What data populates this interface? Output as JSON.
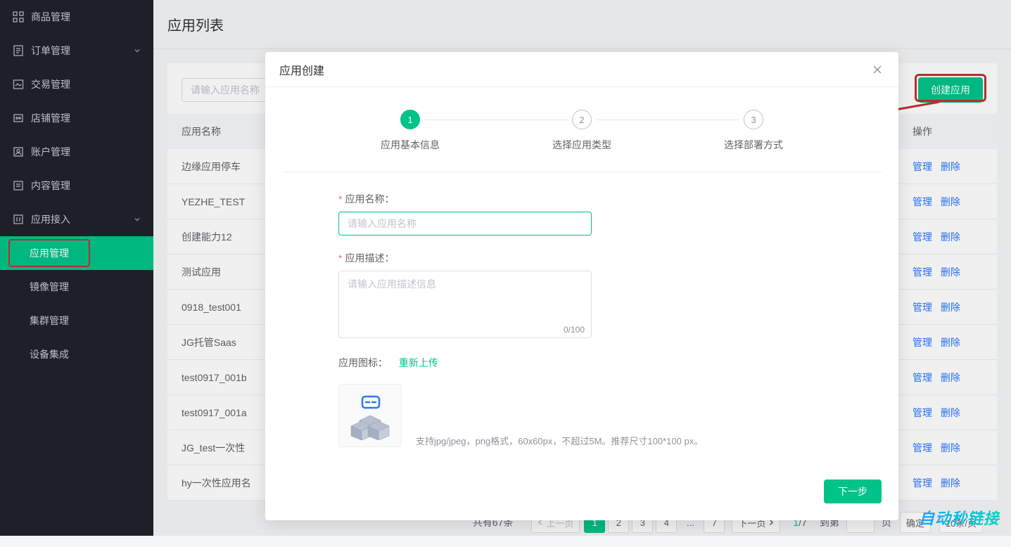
{
  "sidebar": {
    "items": [
      {
        "label": "商品管理",
        "icon": "grid-icon",
        "expandable": false
      },
      {
        "label": "订单管理",
        "icon": "order-icon",
        "expandable": true
      },
      {
        "label": "交易管理",
        "icon": "transaction-icon",
        "expandable": false
      },
      {
        "label": "店铺管理",
        "icon": "shop-icon",
        "expandable": false
      },
      {
        "label": "账户管理",
        "icon": "account-icon",
        "expandable": false
      },
      {
        "label": "内容管理",
        "icon": "content-icon",
        "expandable": false
      },
      {
        "label": "应用接入",
        "icon": "app-access-icon",
        "expandable": true
      }
    ],
    "sub_items": [
      {
        "label": "应用管理",
        "active": true
      },
      {
        "label": "镜像管理",
        "active": false
      },
      {
        "label": "集群管理",
        "active": false
      },
      {
        "label": "设备集成",
        "active": false
      }
    ]
  },
  "page": {
    "title": "应用列表"
  },
  "toolbar": {
    "search_placeholder": "请输入应用名称",
    "create_button": "创建应用"
  },
  "table": {
    "header": {
      "name": "应用名称",
      "actions": "操作"
    },
    "action_manage": "管理",
    "action_delete": "删除",
    "rows": [
      {
        "name": "边缘应用停车"
      },
      {
        "name": "YEZHE_TEST"
      },
      {
        "name": "创建能力12"
      },
      {
        "name": "测试应用"
      },
      {
        "name": "0918_test001"
      },
      {
        "name": "JG托管Saas"
      },
      {
        "name": "test0917_001b"
      },
      {
        "name": "test0917_001a"
      },
      {
        "name": "JG_test一次性"
      },
      {
        "name": "hy一次性应用名"
      }
    ]
  },
  "pagination": {
    "total_text": "共有67条",
    "prev": "上一页",
    "next": "下一页",
    "pages": [
      "1",
      "2",
      "3",
      "4",
      "...",
      "7"
    ],
    "active_page": "1",
    "info_current": "1",
    "info_sep": "/",
    "info_total": "7",
    "goto_prefix": "到第",
    "goto_suffix": "页",
    "confirm": "确定",
    "per_page": "10条/页"
  },
  "modal": {
    "title": "应用创建",
    "steps": [
      {
        "num": "1",
        "label": "应用基本信息"
      },
      {
        "num": "2",
        "label": "选择应用类型"
      },
      {
        "num": "3",
        "label": "选择部署方式"
      }
    ],
    "form": {
      "name_label": "应用名称：",
      "name_placeholder": "请输入应用名称",
      "desc_label": "应用描述：",
      "desc_placeholder": "请输入应用描述信息",
      "desc_count": "0/100",
      "icon_label": "应用图标：",
      "reupload": "重新上传",
      "icon_hint": "支持jpg/jpeg，png格式，60x60px，不超过5M。推荐尺寸100*100 px。"
    },
    "footer": {
      "next": "下一步"
    }
  },
  "watermark": "自动秒链接"
}
